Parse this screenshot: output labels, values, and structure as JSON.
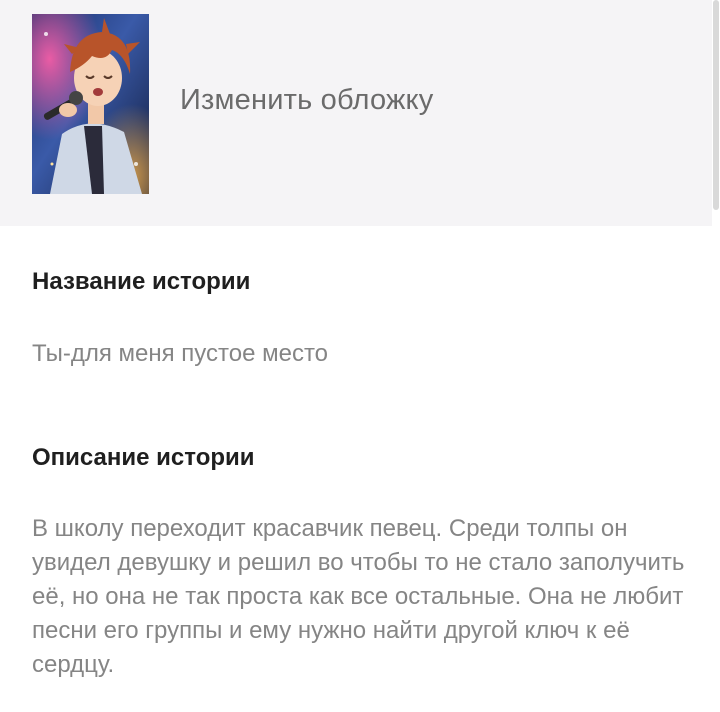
{
  "header": {
    "cover_alt": "Обложка истории",
    "change_cover_label": "Изменить обложку"
  },
  "story": {
    "title_label": "Название истории",
    "title_value": "Ты-для меня пустое место",
    "description_label": "Описание истории",
    "description_value": "В школу переходит красавчик певец. Среди толпы он увидел девушку и решил во чтобы то не стало заполучить её, но она не так проста как все остальные. Она не любит песни его группы и ему нужно найти другой ключ к её сердцу."
  }
}
